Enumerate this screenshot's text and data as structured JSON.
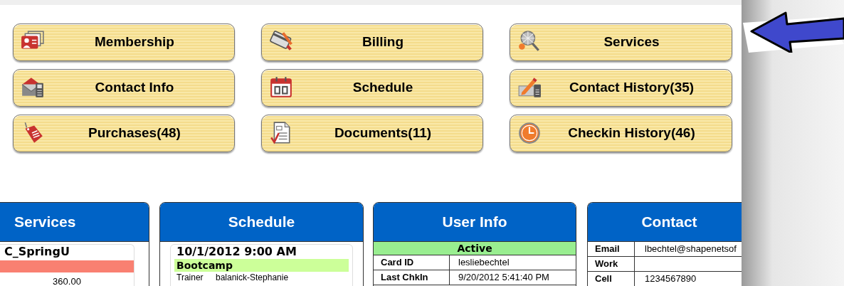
{
  "buttons": [
    {
      "label": "Membership"
    },
    {
      "label": "Billing"
    },
    {
      "label": "Services"
    },
    {
      "label": "Contact Info"
    },
    {
      "label": "Schedule"
    },
    {
      "label": "Contact History(35)"
    },
    {
      "label": "Purchases(48)"
    },
    {
      "label": "Documents(11)"
    },
    {
      "label": "Checkin History(46)"
    }
  ],
  "services_panel": {
    "title": "Services",
    "item": "C_SpringU",
    "amount": "360.00"
  },
  "schedule_panel": {
    "title": "Schedule",
    "date": "10/1/2012 9:00 AM",
    "class": "Bootcamp",
    "rows": [
      {
        "label": "Trainer",
        "value": "balanick-Stephanie"
      }
    ]
  },
  "user_info_panel": {
    "title": "User Info",
    "status": "Active",
    "rows": [
      {
        "label": "Card ID",
        "value": "lesliebechtel"
      },
      {
        "label": "Last ChkIn",
        "value": "9/20/2012 5:41:40 PM"
      }
    ]
  },
  "contact_panel": {
    "title": "Contact",
    "rows": [
      {
        "label": "Email",
        "value": "lbechtel@shapenetsof"
      },
      {
        "label": "Work"
      },
      {
        "label": "Cell",
        "value": "1234567890"
      }
    ]
  }
}
